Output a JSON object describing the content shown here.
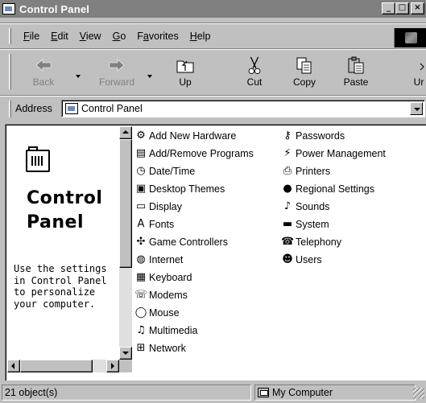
{
  "window": {
    "title": "Control Panel",
    "buttons": {
      "minimize": "_",
      "maximize": "□",
      "close": "×"
    }
  },
  "menubar": {
    "items": [
      {
        "key": "F",
        "rest": "ile"
      },
      {
        "key": "E",
        "rest": "dit"
      },
      {
        "key": "V",
        "rest": "iew"
      },
      {
        "key": "G",
        "rest": "o"
      },
      {
        "pre": "F",
        "key": "a",
        "rest": "vorites"
      },
      {
        "key": "H",
        "rest": "elp"
      }
    ]
  },
  "toolbar": {
    "back": "Back",
    "forward": "Forward",
    "up": "Up",
    "cut": "Cut",
    "copy": "Copy",
    "paste": "Paste",
    "partial": "Ur"
  },
  "address": {
    "label": "Address",
    "value": "Control Panel"
  },
  "leftpane": {
    "title_line1": "Control",
    "title_line2": "Panel",
    "description": "Use the settings in Control Panel to personalize your computer."
  },
  "items": {
    "col1": [
      {
        "label": "Add New Hardware",
        "icon": "hardware-icon"
      },
      {
        "label": "Add/Remove Programs",
        "icon": "programs-icon"
      },
      {
        "label": "Date/Time",
        "icon": "clock-icon"
      },
      {
        "label": "Desktop Themes",
        "icon": "themes-icon"
      },
      {
        "label": "Display",
        "icon": "monitor-icon"
      },
      {
        "label": "Fonts",
        "icon": "font-icon"
      },
      {
        "label": "Game Controllers",
        "icon": "joystick-icon"
      },
      {
        "label": "Internet",
        "icon": "globe-icon"
      },
      {
        "label": "Keyboard",
        "icon": "keyboard-icon"
      },
      {
        "label": "Modems",
        "icon": "modem-icon"
      },
      {
        "label": "Mouse",
        "icon": "mouse-icon"
      },
      {
        "label": "Multimedia",
        "icon": "multimedia-icon"
      },
      {
        "label": "Network",
        "icon": "network-icon"
      }
    ],
    "col2": [
      {
        "label": "Passwords",
        "icon": "key-icon"
      },
      {
        "label": "Power Management",
        "icon": "power-icon"
      },
      {
        "label": "Printers",
        "icon": "printer-icon"
      },
      {
        "label": "Regional Settings",
        "icon": "region-globe-icon"
      },
      {
        "label": "Sounds",
        "icon": "speaker-icon"
      },
      {
        "label": "System",
        "icon": "system-icon"
      },
      {
        "label": "Telephony",
        "icon": "telephone-icon"
      },
      {
        "label": "Users",
        "icon": "users-icon"
      }
    ]
  },
  "status": {
    "count": "21 object(s)",
    "location": "My Computer"
  }
}
